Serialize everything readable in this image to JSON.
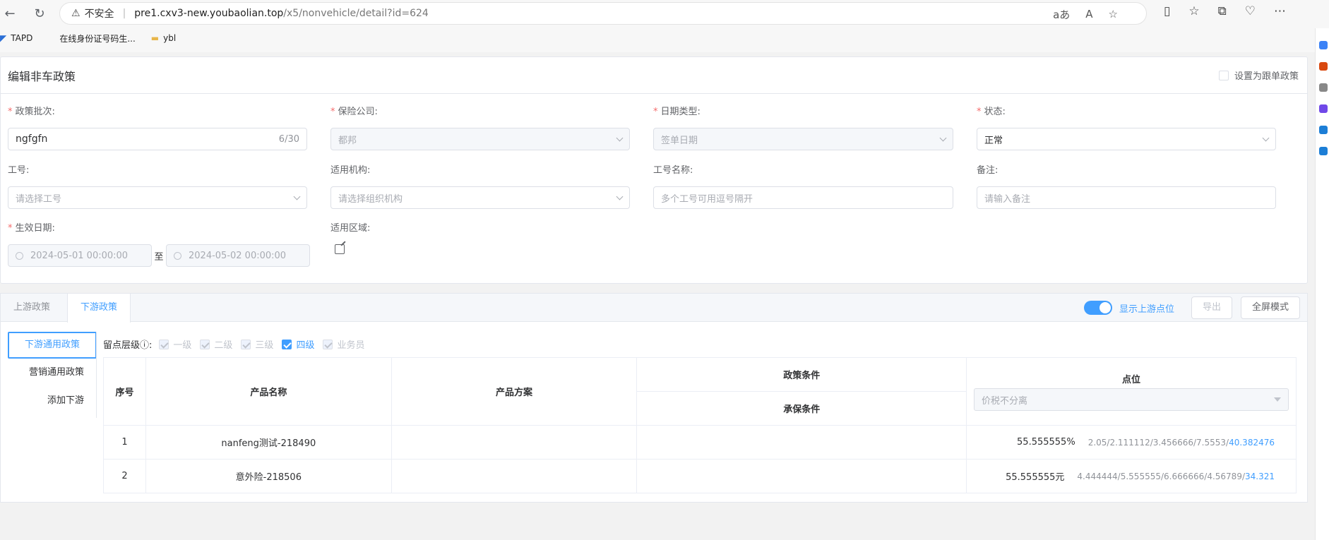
{
  "browser": {
    "insecure": "不安全",
    "host": "pre1.cxv3-new.youbaolian.top",
    "path": "/x5/nonvehicle/detail?id=624",
    "bookmarks": [
      "TAPD",
      "在线身份证号码生...",
      "ybl"
    ]
  },
  "form": {
    "title": "编辑非车政策",
    "follow_label": "设置为跟单政策",
    "fields": {
      "batch": {
        "label": "政策批次:",
        "value": "ngfgfn",
        "count": "6/30"
      },
      "insurer": {
        "label": "保险公司:",
        "value": "都邦"
      },
      "date_type": {
        "label": "日期类型:",
        "value": "签单日期"
      },
      "status": {
        "label": "状态:",
        "value": "正常"
      },
      "job_no": {
        "label": "工号:",
        "placeholder": "请选择工号"
      },
      "org": {
        "label": "适用机构:",
        "placeholder": "请选择组织机构"
      },
      "job_name": {
        "label": "工号名称:",
        "placeholder": "多个工号可用逗号隔开"
      },
      "remark": {
        "label": "备注:",
        "placeholder": "请输入备注"
      },
      "effective": {
        "label": "生效日期:",
        "start": "2024-05-01 00:00:00",
        "sep": "至",
        "end": "2024-05-02 00:00:00"
      },
      "region": {
        "label": "适用区域:"
      }
    }
  },
  "lower": {
    "tabs": [
      "上游政策",
      "下游政策"
    ],
    "active_tab": 1,
    "switch_label": "显示上游点位",
    "export_label": "导出",
    "fullscreen_label": "全屏模式",
    "menu": [
      "下游通用政策",
      "营销通用政策",
      "添加下游"
    ],
    "levels_label": "留点层级ⓘ:",
    "levels": [
      {
        "label": "一级",
        "checked": true,
        "disabled": true
      },
      {
        "label": "二级",
        "checked": true,
        "disabled": true
      },
      {
        "label": "三级",
        "checked": true,
        "disabled": true
      },
      {
        "label": "四级",
        "checked": true,
        "disabled": false
      },
      {
        "label": "业务员",
        "checked": true,
        "disabled": true
      }
    ],
    "table": {
      "headers": {
        "index": "序号",
        "product": "产品名称",
        "plan": "产品方案",
        "policy_cond": "政策条件",
        "underwrite_cond": "承保条件",
        "points": "点位",
        "points_select": "价税不分离"
      },
      "rows": [
        {
          "index": "1",
          "product": "nanfeng测试-218490",
          "value": "55.555555%",
          "chain": "2.05/2.111112/3.456666/7.5553/",
          "last": "40.382476"
        },
        {
          "index": "2",
          "product": "意外险-218506",
          "value": "55.555555元",
          "chain": "4.444444/5.555555/6.666666/4.56789/",
          "last": "34.321"
        }
      ]
    }
  }
}
